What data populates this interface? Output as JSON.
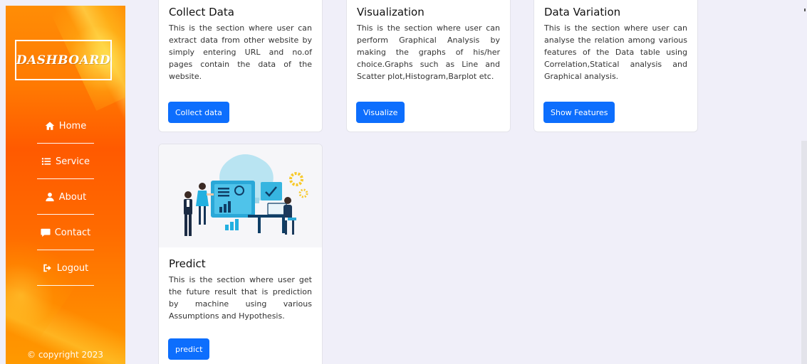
{
  "sidebar": {
    "brand": "Dashboard",
    "nav": [
      {
        "label": "Home",
        "icon": "home-icon"
      },
      {
        "label": "Service",
        "icon": "list-icon"
      },
      {
        "label": "About",
        "icon": "user-icon"
      },
      {
        "label": "Contact",
        "icon": "chat-icon"
      },
      {
        "label": "Logout",
        "icon": "logout-icon"
      }
    ],
    "copyright": "© copyright 2023"
  },
  "cards": [
    {
      "title": "Collect Data",
      "text": "This is the section where user can extract data from other website by simply entering URL and no.of pages contain the data of the website.",
      "button": "Collect data"
    },
    {
      "title": "Visualization",
      "text": "This is the section where user can perform Graphical Analysis by making the graphs of his/her choice.Graphs such as Line and Scatter plot,Histogram,Barplot etc.",
      "button": "Visualize"
    },
    {
      "title": "Data Variation",
      "text": "This is the section where user can analyse the relation among various features of the Data table using Correlation,Statical analysis and Graphical analysis.",
      "button": "Show Features"
    },
    {
      "title": "Predict",
      "text": "This is the section where user get the future result that is prediction by machine using various Assumptions and Hypothesis.",
      "button": "predict"
    }
  ],
  "colors": {
    "primary_button": "#0d6efd",
    "page_background": "#f0eff9",
    "sidebar_orange": "#ff6a00"
  }
}
